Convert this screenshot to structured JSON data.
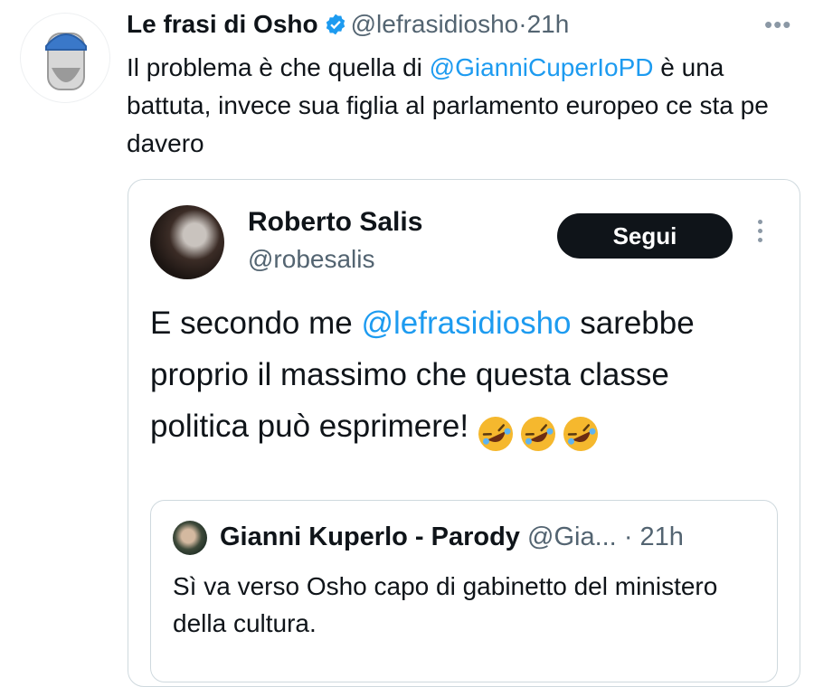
{
  "tweet": {
    "author": {
      "name": "Le frasi di Osho",
      "handle": "@lefrasidiosho"
    },
    "separator": "·",
    "time": "21h",
    "more": "•••",
    "text_before": "Il problema è che quella di ",
    "mention": "@GianniCuperIoPD",
    "text_after": " è una battuta, invece sua figlia al parlamento europeo ce sta pe davero"
  },
  "quote": {
    "author": {
      "name": "Roberto Salis",
      "handle": "@robesalis"
    },
    "follow_label": "Segui",
    "text_before": "E secondo me ",
    "mention": "@lefrasidiosho",
    "text_after": " sarebbe proprio il massimo che questa classe politica può esprimere!",
    "inner": {
      "author": {
        "name": "Gianni Kuperlo - Parody",
        "handle": "@Gia..."
      },
      "time": "· 21h",
      "text": "Sì va verso Osho capo di gabinetto del ministero della cultura."
    }
  },
  "colors": {
    "accent": "#1d9bf0",
    "text": "#0f1419",
    "muted": "#536471",
    "border": "#cfd9de"
  }
}
